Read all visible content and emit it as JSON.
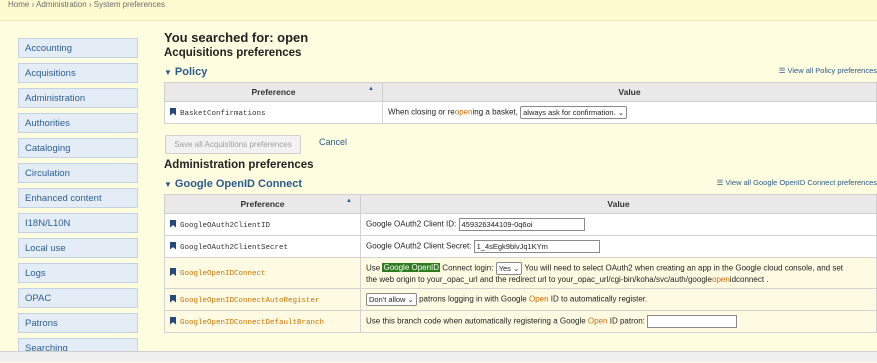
{
  "breadcrumb": "Home › Administration › System preferences",
  "sidebar": {
    "items": [
      {
        "label": "Accounting"
      },
      {
        "label": "Acquisitions"
      },
      {
        "label": "Administration"
      },
      {
        "label": "Authorities"
      },
      {
        "label": "Cataloging"
      },
      {
        "label": "Circulation"
      },
      {
        "label": "Enhanced content"
      },
      {
        "label": "I18N/L10N"
      },
      {
        "label": "Local use"
      },
      {
        "label": "Logs"
      },
      {
        "label": "OPAC"
      },
      {
        "label": "Patrons"
      },
      {
        "label": "Searching"
      }
    ]
  },
  "search_heading": "You searched for: open",
  "acq": {
    "heading": "Acquisitions preferences",
    "section": "Policy",
    "view_all": "View all Policy preferences",
    "col_pref": "Preference",
    "col_value": "Value",
    "rows": [
      {
        "name": "BasketConfirmations",
        "pre": "When closing or re",
        "mark": "open",
        "post": "ing a basket,",
        "select": "always ask for confirmation."
      }
    ],
    "save_label": "Save all Acquisitions preferences",
    "cancel_label": "Cancel"
  },
  "admin": {
    "heading": "Administration preferences",
    "section": "Google OpenID Connect",
    "view_all": "View all Google OpenID Connect preferences",
    "col_pref": "Preference",
    "col_value": "Value",
    "row1": {
      "name": "GoogleOAuth2ClientID",
      "label": "Google OAuth2 Client ID:",
      "value": "459326344109-0q6oi"
    },
    "row2": {
      "name": "GoogleOAuth2ClientSecret",
      "label": "Google OAuth2 Client Secret:",
      "value": "1_4sEgk9blvJq1KYm"
    },
    "row3": {
      "name": "GoogleOpenIDConnect",
      "use": "Use",
      "mark": "Google OpenID",
      "mid": "Connect login:",
      "select": "Yes",
      "line1_tail": "You will need to select OAuth2 when creating an app in the Google cloud console, and set",
      "line2_pre": "the web origin to your_opac_url and the redirect url to your_opac_url/cgi-bin/koha/svc/auth/google",
      "line2_mark": "open",
      "line2_post": "idconnect ."
    },
    "row4": {
      "name": "GoogleOpenIDConnectAutoRegister",
      "select": "Don't allow",
      "pre": "patrons logging in with Google",
      "mark": "Open",
      "post": "ID to automatically register."
    },
    "row5": {
      "name": "GoogleOpenIDConnectDefaultBranch",
      "pre": "Use this branch code when automatically registering a Google",
      "mark": "Open",
      "post": "ID patron:",
      "value": ""
    }
  }
}
